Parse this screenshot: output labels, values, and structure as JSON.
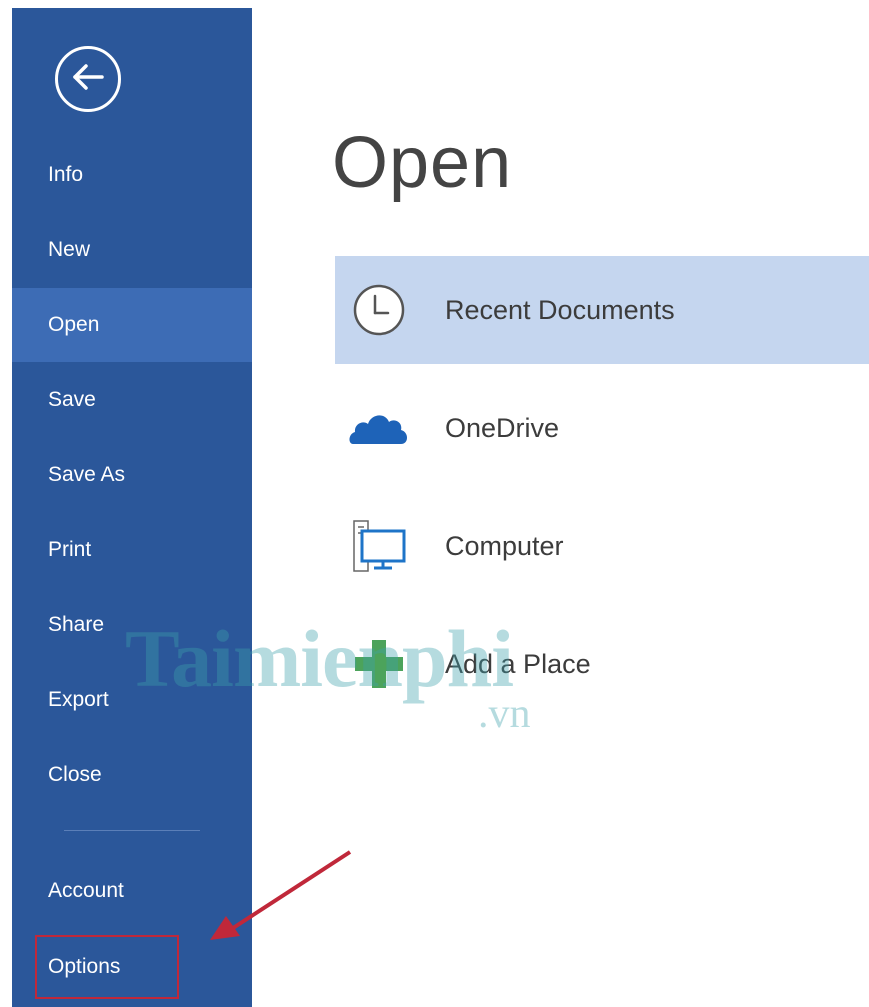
{
  "sidebar": {
    "back_icon": "back-arrow-icon",
    "items": [
      {
        "label": "Info"
      },
      {
        "label": "New"
      },
      {
        "label": "Open"
      },
      {
        "label": "Save"
      },
      {
        "label": "Save As"
      },
      {
        "label": "Print"
      },
      {
        "label": "Share"
      },
      {
        "label": "Export"
      },
      {
        "label": "Close"
      }
    ],
    "bottom_items": [
      {
        "label": "Account"
      },
      {
        "label": "Options"
      }
    ]
  },
  "main": {
    "title": "Open",
    "places": [
      {
        "label": "Recent Documents",
        "icon": "clock-icon"
      },
      {
        "label": "OneDrive",
        "icon": "cloud-icon"
      },
      {
        "label": "Computer",
        "icon": "computer-icon"
      },
      {
        "label": "Add a Place",
        "icon": "plus-icon"
      }
    ]
  },
  "watermark": {
    "text": "Taimienphi",
    "sub": ".vn"
  },
  "colors": {
    "sidebar": "#2b579a",
    "sidebar_selected": "#3d6cb5",
    "row_selected": "#c5d6ef",
    "annotation": "#c0283a"
  }
}
